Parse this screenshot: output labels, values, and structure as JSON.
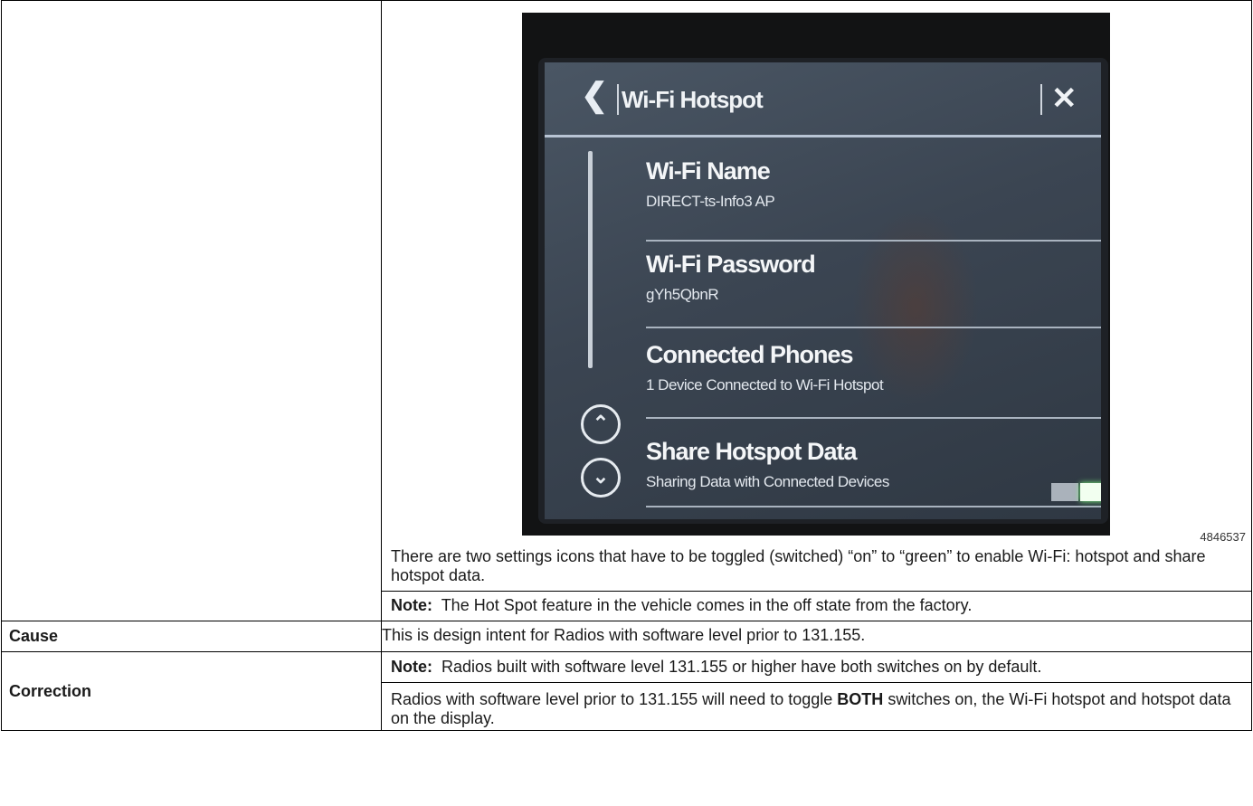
{
  "figure": {
    "id": "4846537",
    "screen": {
      "back_icon": "chevron-left-icon",
      "title": "Wi-Fi Hotspot",
      "close_icon": "close-icon",
      "items": [
        {
          "title": "Wi-Fi Name",
          "subtitle": "DIRECT-ts-Info3 AP"
        },
        {
          "title": "Wi-Fi Password",
          "subtitle": "gYh5QbnR"
        },
        {
          "title": "Connected Phones",
          "subtitle": "1 Device Connected to Wi-Fi Hotspot"
        },
        {
          "title": "Share Hotspot Data",
          "subtitle": "Sharing Data with Connected Devices",
          "toggle_on": true
        }
      ],
      "toggle_color": "#7dff7d"
    }
  },
  "rows": {
    "intro": {
      "para1": "There are two settings icons that have to be toggled (switched) “on” to “green” to enable Wi-Fi: hotspot and share hotspot data.",
      "note_label": "Note:",
      "note_text": "The Hot Spot feature in the vehicle comes in the off state from the factory."
    },
    "cause": {
      "label": "Cause",
      "text": "This is design intent for Radios with software level prior to 131.155."
    },
    "correction": {
      "label": "Correction",
      "note_label": "Note:",
      "note_text": "Radios built with software level 131.155 or higher have both switches on by default.",
      "text_before": "Radios with software level prior to 131.155 will need to toggle",
      "text_bold": "BOTH",
      "text_after": "switches on, the Wi-Fi hotspot and hotspot data on the display."
    }
  }
}
